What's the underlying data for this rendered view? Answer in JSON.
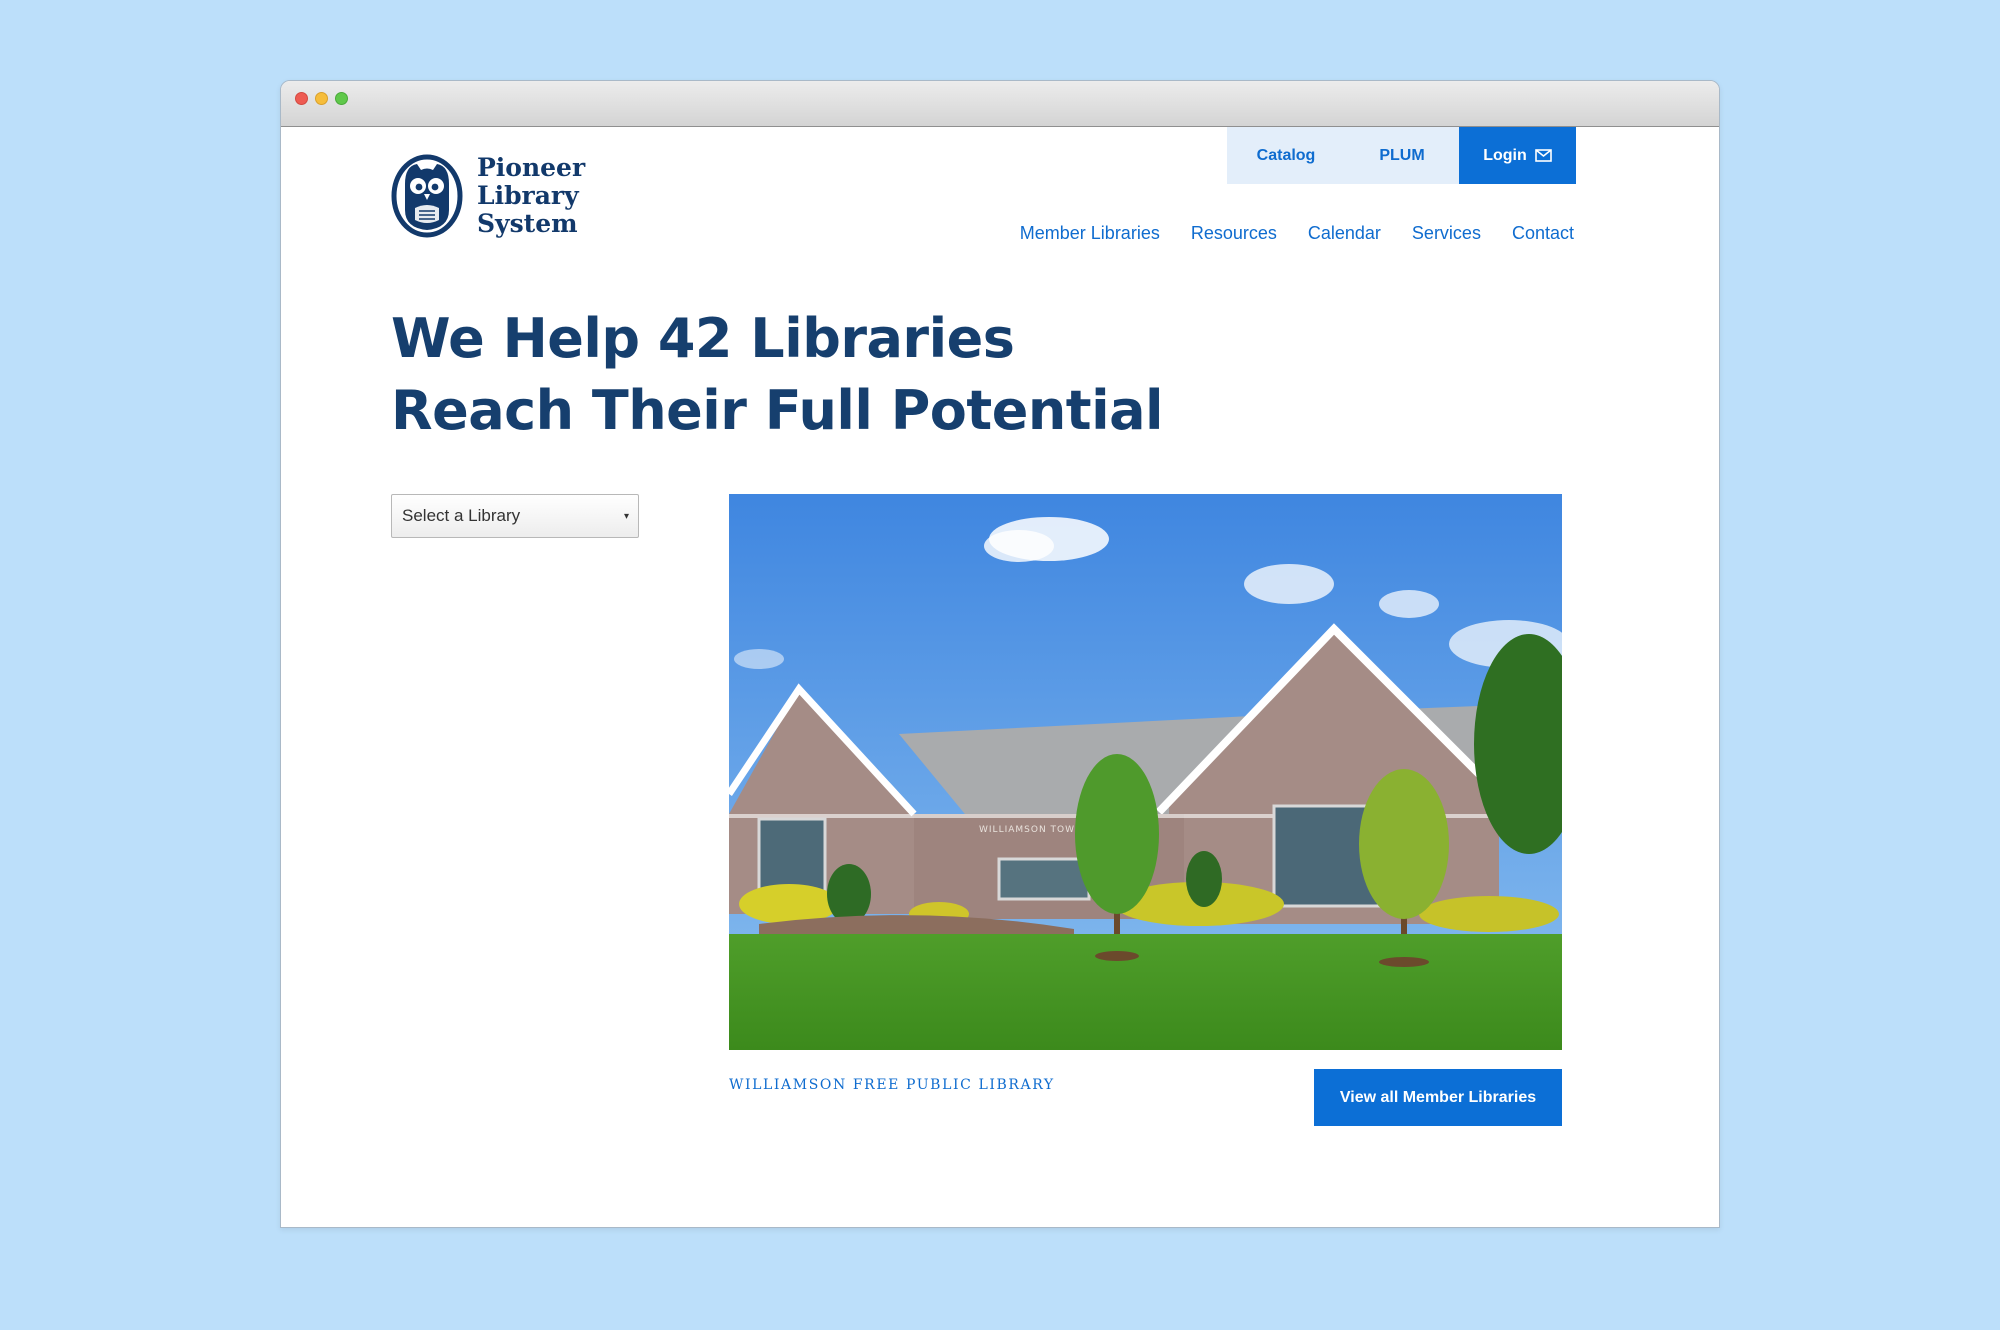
{
  "site": {
    "logo_lines": [
      "Pioneer",
      "Library",
      "System"
    ]
  },
  "utility_nav": {
    "catalog": "Catalog",
    "plum": "PLUM",
    "login": "Login"
  },
  "main_nav": [
    "Member Libraries",
    "Resources",
    "Calendar",
    "Services",
    "Contact"
  ],
  "hero": {
    "line1": "We Help 42 Libraries",
    "line2": "Reach Their Full Potential"
  },
  "library_select": {
    "selected": "Select a Library"
  },
  "featured": {
    "caption": "Williamson Free Public Library",
    "sign_text": "WILLIAMSON TOWN C",
    "button": "View all Member Libraries"
  },
  "colors": {
    "brand_navy": "#163f6e",
    "brand_blue": "#0c6fd6",
    "utility_bg": "#e3eefa",
    "page_bg": "#bcdffa"
  }
}
